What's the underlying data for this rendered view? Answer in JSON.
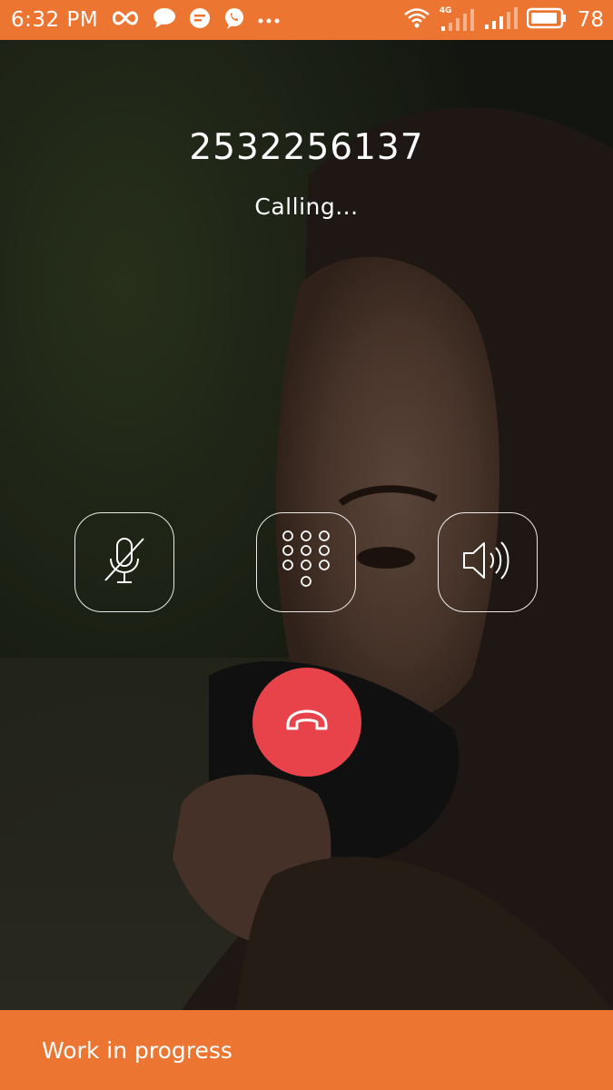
{
  "status_bar": {
    "time": "6:32 PM",
    "left_icons": [
      "infinity-icon",
      "chat-bubble-icon",
      "message-icon",
      "viber-icon",
      "more-dots-icon"
    ],
    "right_icons": [
      "wifi-icon",
      "signal-4g-icon",
      "signal-icon",
      "battery-icon"
    ],
    "network_label": "4G",
    "battery_level": "78",
    "background_color": "#ec7531"
  },
  "call": {
    "number": "2532256137",
    "status": "Calling..."
  },
  "controls": {
    "mute_icon": "mic-off-icon",
    "keypad_icon": "dialpad-icon",
    "speaker_icon": "speaker-icon",
    "end_call_icon": "phone-hangup-icon",
    "end_call_color": "#e8434a"
  },
  "snackbar": {
    "message": "Work in progress",
    "background_color": "#ec7531"
  }
}
